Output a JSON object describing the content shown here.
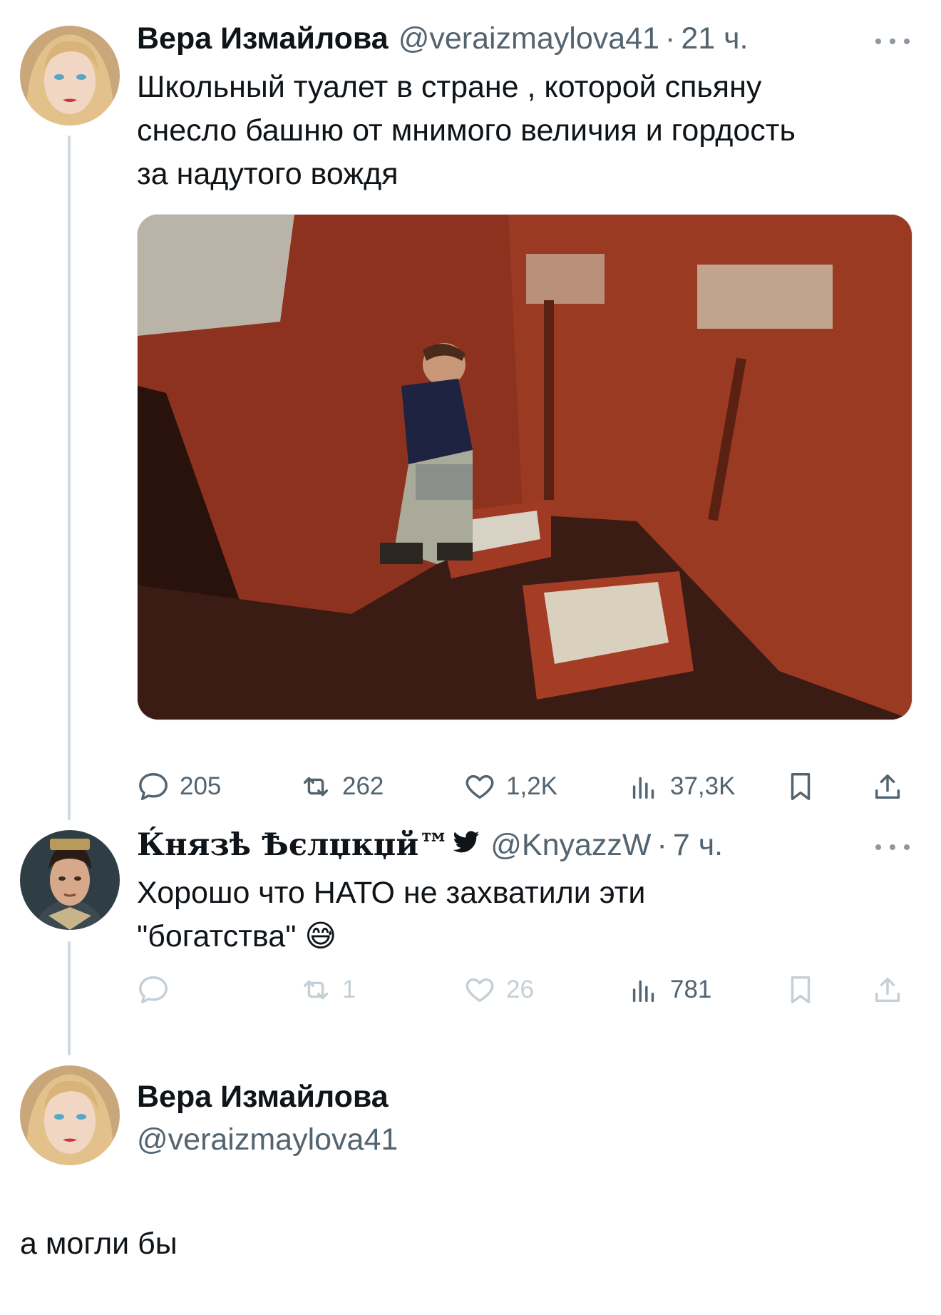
{
  "tweet1": {
    "author_name": "Вера Измайлова",
    "handle": "@veraizmaylova41",
    "separator": "·",
    "time": "21 ч.",
    "text_lines": [
      "Школьный туалет в стране , которой спьяну",
      "снесло башню от мнимого величия и гордость",
      "за надутого вождя"
    ],
    "stats": {
      "replies": "205",
      "retweets": "262",
      "likes": "1,2K",
      "views": "37,3K"
    }
  },
  "tweet2": {
    "author_name": "Ќнязѣ Ѣєлџкџй™",
    "handle": "@KnyazzW",
    "separator": "·",
    "time": "7 ч.",
    "text_lines": [
      "Хорошо что НАТО не захватили эти",
      "\"богатства\" 😅"
    ],
    "stats": {
      "replies": "",
      "retweets": "1",
      "likes": "26",
      "views": "781"
    }
  },
  "reply_composer": {
    "author_name": "Вера Измайлова",
    "handle": "@veraizmaylova41",
    "text": "а могли бы"
  },
  "icons": [
    "reply-icon",
    "retweet-icon",
    "like-icon",
    "views-icon",
    "bookmark-icon",
    "share-icon",
    "more-icon",
    "twitter-bird-icon"
  ],
  "colors": {
    "text": "#0f1419",
    "secondary": "#536471",
    "faded": "#c4cfd6",
    "thread_line": "#cfd9de",
    "bird": "#0f1419"
  }
}
